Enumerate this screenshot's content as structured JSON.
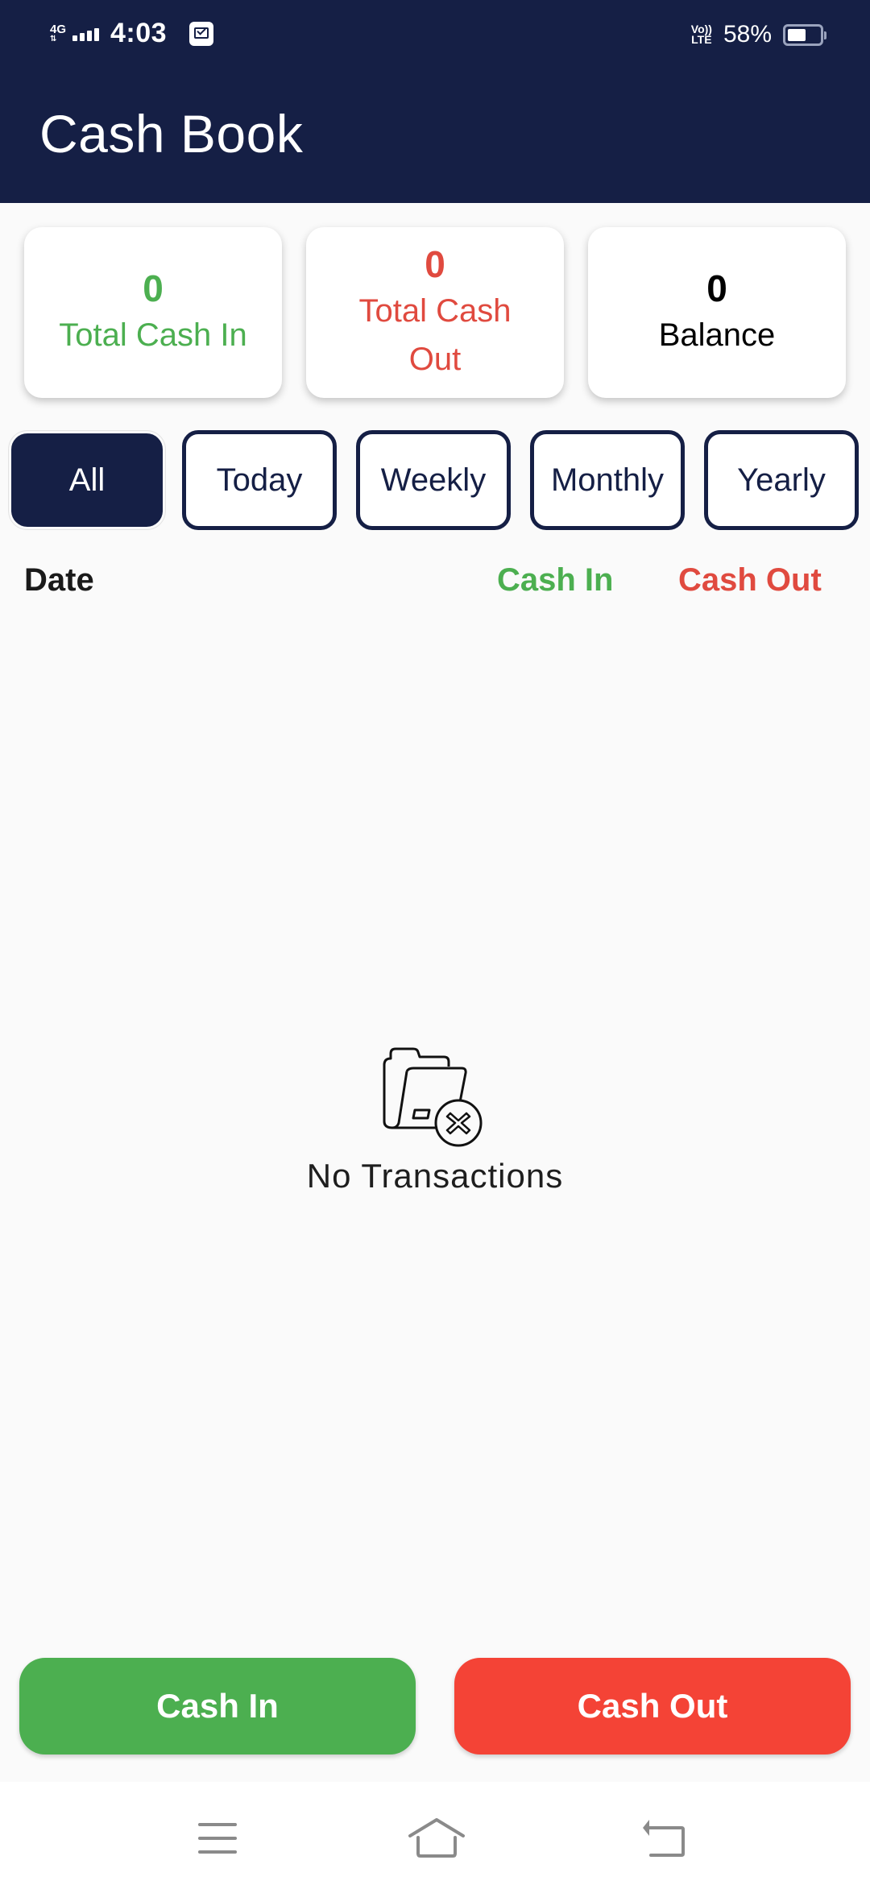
{
  "status_bar": {
    "network": "4G",
    "time": "4:03",
    "volte": [
      "Vo))",
      "LTE"
    ],
    "battery_percent_label": "58%",
    "battery_level": 0.58,
    "icons": [
      "network-4g-icon",
      "signal-icon",
      "notification-icon",
      "volte-icon",
      "battery-icon"
    ]
  },
  "header": {
    "title": "Cash Book"
  },
  "summary": {
    "cash_in": {
      "value": "0",
      "label": "Total Cash In",
      "color": "#4caf50"
    },
    "cash_out": {
      "value": "0",
      "label": "Total Cash Out",
      "color": "#e04a3f"
    },
    "balance": {
      "value": "0",
      "label": "Balance",
      "color": "#000000"
    }
  },
  "filters": {
    "active": "All",
    "items": [
      {
        "label": "All"
      },
      {
        "label": "Today"
      },
      {
        "label": "Weekly"
      },
      {
        "label": "Monthly"
      },
      {
        "label": "Yearly"
      }
    ]
  },
  "table": {
    "columns": {
      "date": "Date",
      "cash_in": "Cash In",
      "cash_out": "Cash Out"
    },
    "rows": []
  },
  "empty_state": {
    "icon": "empty-folder-icon",
    "text": "No Transactions"
  },
  "actions": {
    "cash_in_label": "Cash In",
    "cash_out_label": "Cash Out"
  },
  "navbar": {
    "icons": [
      "menu-icon",
      "home-icon",
      "back-icon"
    ]
  },
  "colors": {
    "primary": "#151f45",
    "green": "#4caf50",
    "red": "#f44336",
    "background": "#fafafa"
  }
}
